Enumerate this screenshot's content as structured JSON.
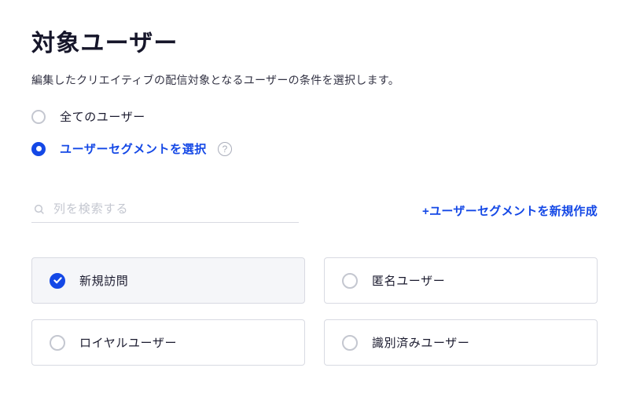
{
  "header": {
    "title": "対象ユーザー",
    "description": "編集したクリエイティブの配信対象となるユーザーの条件を選択します。"
  },
  "targetMode": {
    "options": [
      {
        "id": "all",
        "label": "全てのユーザー",
        "selected": false
      },
      {
        "id": "segment",
        "label": "ユーザーセグメントを選択",
        "selected": true,
        "help": true
      }
    ]
  },
  "search": {
    "placeholder": "列を検索する",
    "value": ""
  },
  "createSegment": {
    "label": "+ユーザーセグメントを新規作成"
  },
  "segments": [
    {
      "id": "new-visit",
      "label": "新規訪問",
      "checked": true
    },
    {
      "id": "anonymous",
      "label": "匿名ユーザー",
      "checked": false
    },
    {
      "id": "loyal",
      "label": "ロイヤルユーザー",
      "checked": false
    },
    {
      "id": "identified",
      "label": "識別済みユーザー",
      "checked": false
    }
  ]
}
